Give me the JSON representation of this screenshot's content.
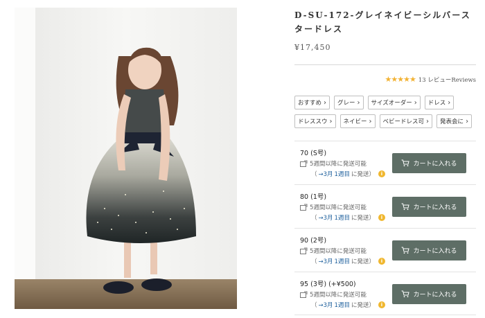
{
  "product": {
    "title": "D-SU-172-グレイネイビーシルバースタードレス",
    "price": "¥17,450",
    "image_alt_icon": "dress-photo"
  },
  "reviews": {
    "stars": "★★★★★",
    "rating": 5,
    "text": "13 レビューReviews",
    "star_color": "#f2b233"
  },
  "tags": [
    {
      "label": "おすすめ"
    },
    {
      "label": "グレー"
    },
    {
      "label": "サイズオーダー"
    },
    {
      "label": "ドレス"
    },
    {
      "label": "ドレススウ"
    },
    {
      "label": "ネイビー"
    },
    {
      "label": "ベビードレス可"
    },
    {
      "label": "発表会に"
    }
  ],
  "variants": [
    {
      "size": "70 (S号)",
      "ship": "5週間以降に発送可能",
      "open": "（",
      "arrow": "→3月",
      "week": "1週目",
      "suffix": "に発送）",
      "cart": "カートに入れる"
    },
    {
      "size": "80 (1号)",
      "ship": "5週間以降に発送可能",
      "open": "（",
      "arrow": "→3月",
      "week": "1週目",
      "suffix": "に発送）",
      "cart": "カートに入れる"
    },
    {
      "size": "90 (2号)",
      "ship": "5週間以降に発送可能",
      "open": "（",
      "arrow": "→3月",
      "week": "1週目",
      "suffix": "に発送）",
      "cart": "カートに入れる"
    },
    {
      "size": "95 (3号) (+¥500)",
      "ship": "5週間以降に発送可能",
      "open": "（",
      "arrow": "→3月",
      "week": "1週目",
      "suffix": "に発送）",
      "cart": "カートに入れる"
    }
  ],
  "colors": {
    "cart_button": "#5e6e66",
    "link_blue": "#1d5f9c",
    "info_dot": "#f0b72f"
  }
}
